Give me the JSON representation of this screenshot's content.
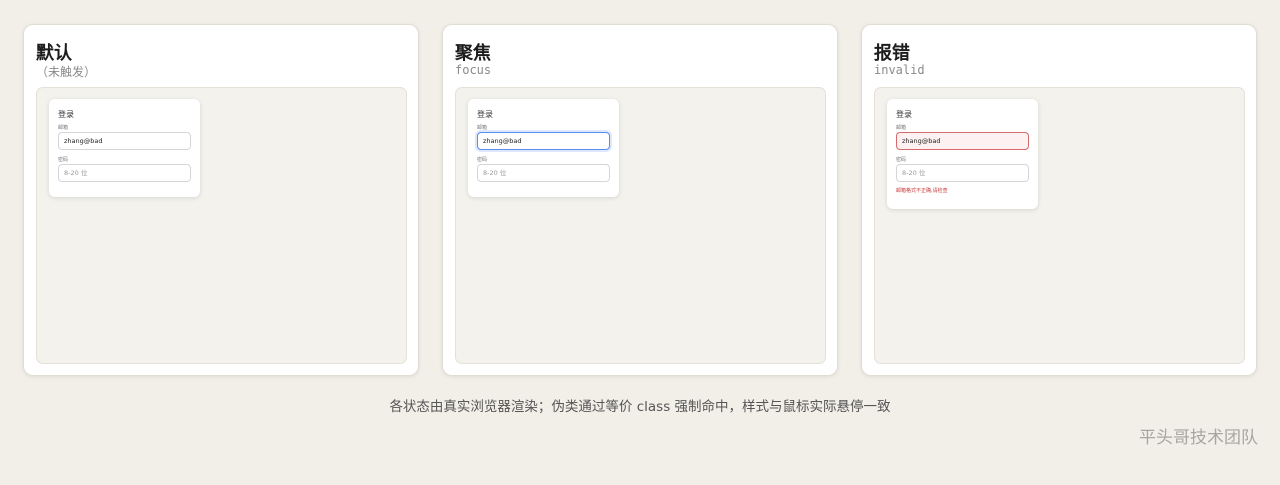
{
  "panels": [
    {
      "title": "默认",
      "subtitle": "（未触发）",
      "card": {
        "title": "登录",
        "email_label": "邮箱",
        "email_value": "zhang@bad",
        "password_label": "密码",
        "password_placeholder": "8-20 位"
      }
    },
    {
      "title": "聚焦",
      "subtitle": "focus",
      "card": {
        "title": "登录",
        "email_label": "邮箱",
        "email_value": "zhang@bad",
        "password_label": "密码",
        "password_placeholder": "8-20 位"
      }
    },
    {
      "title": "报错",
      "subtitle": "invalid",
      "card": {
        "title": "登录",
        "email_label": "邮箱",
        "email_value": "zhang@bad",
        "password_label": "密码",
        "password_placeholder": "8-20 位",
        "error": "邮箱格式不正确,请检查"
      }
    }
  ],
  "caption": "各状态由真实浏览器渲染；伪类通过等价 class 强制命中，样式与鼠标实际悬停一致",
  "brand": "平头哥技术团队",
  "colors": {
    "focus_border": "#5b8def",
    "error_border": "#d46a6a",
    "error_text": "#c73a3a",
    "background": "#f2efe9"
  }
}
